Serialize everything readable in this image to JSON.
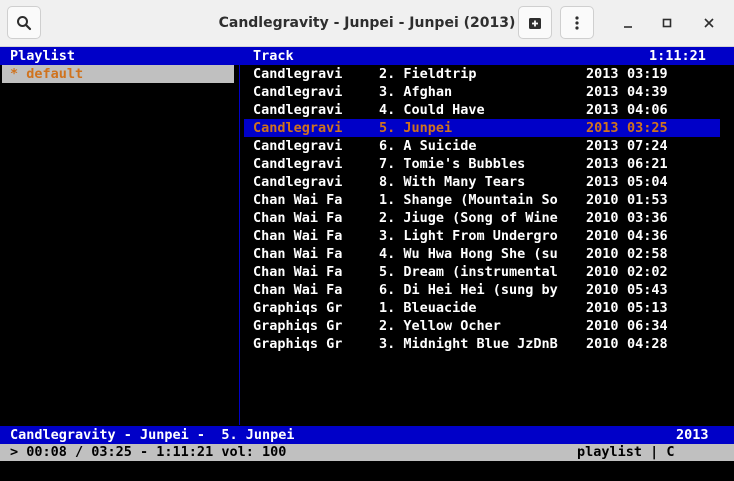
{
  "window": {
    "title": "Candlegravity - Junpei - Junpei (2013)",
    "buttons": {
      "search_icon": "magnifier",
      "playlist_add_icon": "playlist-add",
      "menu_icon": "vertical-dots"
    }
  },
  "colors": {
    "header_bg": "#0000c8",
    "selected_fg": "#d0731e",
    "left_selected_bg": "#c0c0c0",
    "status_bg": "#c0c0c0"
  },
  "left": {
    "header": "Playlist",
    "items": [
      {
        "label": "* default"
      }
    ]
  },
  "right": {
    "header": "Track",
    "total_time": "1:11:21",
    "tracks": [
      {
        "artist": "Candlegravi",
        "track": "2. Fieldtrip",
        "year": "2013",
        "dur": "03:19"
      },
      {
        "artist": "Candlegravi",
        "track": "3. Afghan",
        "year": "2013",
        "dur": "04:39"
      },
      {
        "artist": "Candlegravi",
        "track": "4. Could Have",
        "year": "2013",
        "dur": "04:06"
      },
      {
        "artist": "Candlegravi",
        "track": "5. Junpei",
        "year": "2013",
        "dur": "03:25"
      },
      {
        "artist": "Candlegravi",
        "track": "6. A Suicide",
        "year": "2013",
        "dur": "07:24"
      },
      {
        "artist": "Candlegravi",
        "track": "7. Tomie's Bubbles",
        "year": "2013",
        "dur": "06:21"
      },
      {
        "artist": "Candlegravi",
        "track": "8. With Many Tears",
        "year": "2013",
        "dur": "05:04"
      },
      {
        "artist": "Chan Wai Fa",
        "track": "1. Shange (Mountain So",
        "year": "2010",
        "dur": "01:53"
      },
      {
        "artist": "Chan Wai Fa",
        "track": "2. Jiuge (Song of Wine",
        "year": "2010",
        "dur": "03:36"
      },
      {
        "artist": "Chan Wai Fa",
        "track": "3. Light From Undergro",
        "year": "2010",
        "dur": "04:36"
      },
      {
        "artist": "Chan Wai Fa",
        "track": "4. Wu Hwa Hong She (su",
        "year": "2010",
        "dur": "02:58"
      },
      {
        "artist": "Chan Wai Fa",
        "track": "5. Dream (instrumental",
        "year": "2010",
        "dur": "02:02"
      },
      {
        "artist": "Chan Wai Fa",
        "track": "6. Di Hei Hei (sung by",
        "year": "2010",
        "dur": "05:43"
      },
      {
        "artist": "Graphiqs Gr",
        "track": "1. Bleuacide",
        "year": "2010",
        "dur": "05:13"
      },
      {
        "artist": "Graphiqs Gr",
        "track": "2. Yellow Ocher",
        "year": "2010",
        "dur": "06:34"
      },
      {
        "artist": "Graphiqs Gr",
        "track": "3. Midnight Blue JzDnB",
        "year": "2010",
        "dur": "04:28"
      }
    ],
    "selected_index": 3
  },
  "now_playing": {
    "text": "Candlegravity - Junpei -  5. Junpei",
    "year": "2013"
  },
  "status": {
    "left": "> 00:08 / 03:25 - 1:11:21 vol: 100",
    "right": "playlist | C"
  }
}
